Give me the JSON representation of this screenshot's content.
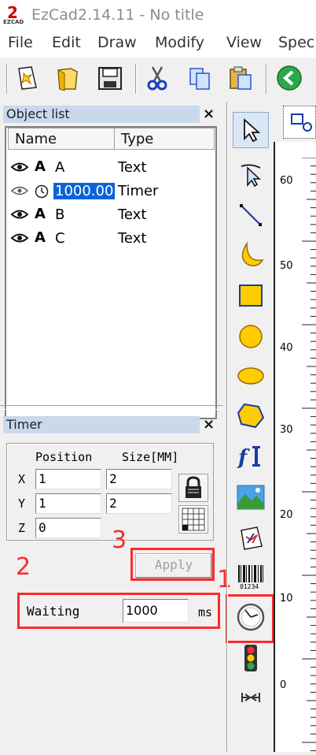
{
  "window": {
    "title": "EzCad2.14.11 - No title",
    "logo_text": "EZCAD"
  },
  "menu": [
    "File",
    "Edit",
    "Draw",
    "Modify",
    "View",
    "Spec"
  ],
  "toolbar": {
    "icons": [
      "new-icon",
      "open-icon",
      "save-icon",
      "cut-icon",
      "copy-icon",
      "paste-icon",
      "back-arrow-icon"
    ]
  },
  "object_list": {
    "title": "Object list",
    "columns": [
      "Name",
      "Type"
    ],
    "rows": [
      {
        "icon": "A",
        "name": "A",
        "type": "Text"
      },
      {
        "icon": "clock",
        "name": "1000.00",
        "type": "Timer",
        "selected": true
      },
      {
        "icon": "A",
        "name": "B",
        "type": "Text"
      },
      {
        "icon": "A",
        "name": "C",
        "type": "Text"
      }
    ]
  },
  "timer_panel": {
    "title": "Timer",
    "position_label": "Position",
    "size_label": "Size[MM]",
    "axes": [
      "X",
      "Y",
      "Z"
    ],
    "position": {
      "x": "1",
      "y": "1",
      "z": "0"
    },
    "size": {
      "x": "2",
      "y": "2"
    },
    "apply_label": "Apply",
    "waiting_label": "Waiting",
    "waiting_value": "1000",
    "waiting_unit": "ms"
  },
  "annotations": {
    "one": "1",
    "two": "2",
    "three": "3"
  },
  "draw_tools": [
    "pointer-icon",
    "node-edit-icon",
    "line-icon",
    "curve-icon",
    "rectangle-icon",
    "circle-icon",
    "ellipse-icon",
    "polygon-icon",
    "text-icon",
    "bitmap-icon",
    "vector-file-icon",
    "barcode-icon",
    "timer-icon",
    "io-signal-icon",
    "extend-axis-icon"
  ],
  "barcode_digits": "01234",
  "ruler": {
    "labels": [
      "60",
      "50",
      "40",
      "30",
      "20",
      "10",
      "0"
    ]
  },
  "colors": {
    "highlight": "#ff2a2a",
    "selection": "#0a64d8",
    "panel_header": "#c9d9eb"
  }
}
